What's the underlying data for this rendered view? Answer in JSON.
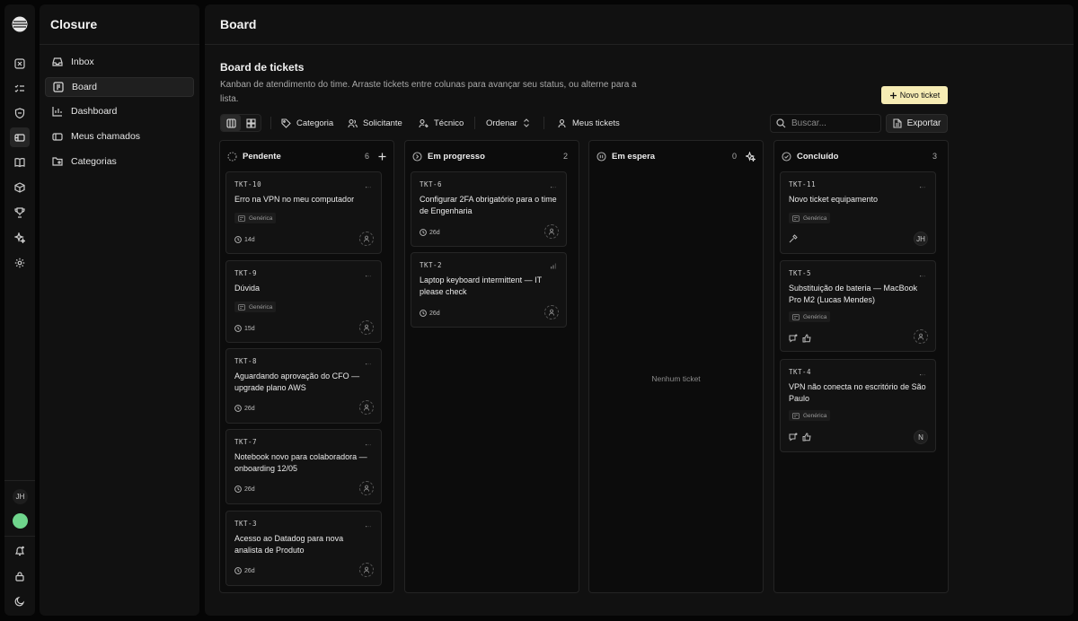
{
  "app": {
    "name": "Closure"
  },
  "rail": {
    "avatar_initials": "JH"
  },
  "sidebar": {
    "items": [
      {
        "label": "Inbox",
        "icon": "inbox-icon"
      },
      {
        "label": "Board",
        "icon": "board-icon",
        "active": true
      },
      {
        "label": "Dashboard",
        "icon": "chart-icon"
      },
      {
        "label": "Meus chamados",
        "icon": "ticket-icon"
      },
      {
        "label": "Categorias",
        "icon": "folder-tag-icon"
      }
    ]
  },
  "header": {
    "title": "Board"
  },
  "section": {
    "title": "Board de tickets",
    "description": "Kanban de atendimento do time. Arraste tickets entre colunas para avançar seu status, ou alterne para a lista."
  },
  "actions": {
    "new_ticket": "Novo ticket",
    "export": "Exportar"
  },
  "toolbar": {
    "filters": [
      "Categoria",
      "Solicitante",
      "Técnico"
    ],
    "sort_label": "Ordenar",
    "my_tickets": "Meus tickets",
    "search_placeholder": "Buscar..."
  },
  "columns": [
    {
      "name": "Pendente",
      "count": "6",
      "cards": [
        {
          "id": "TKT-10",
          "title": "Erro na VPN no meu computador",
          "tag": "Genérica",
          "age": "14d"
        },
        {
          "id": "TKT-9",
          "title": "Dúvida",
          "tag": "Genérica",
          "age": "15d"
        },
        {
          "id": "TKT-8",
          "title": "Aguardando aprovação do CFO — upgrade plano AWS",
          "age": "26d"
        },
        {
          "id": "TKT-7",
          "title": "Notebook novo para colaboradora — onboarding 12/05",
          "age": "26d"
        },
        {
          "id": "TKT-3",
          "title": "Acesso ao Datadog para nova analista de Produto",
          "age": "26d"
        }
      ]
    },
    {
      "name": "Em progresso",
      "count": "2",
      "cards": [
        {
          "id": "TKT-6",
          "title": "Configurar 2FA obrigatório para o time de Engenharia",
          "age": "26d"
        },
        {
          "id": "TKT-2",
          "title": "Laptop keyboard intermittent — IT please check",
          "age": "26d"
        }
      ]
    },
    {
      "name": "Em espera",
      "count": "0",
      "empty_text": "Nenhum ticket"
    },
    {
      "name": "Concluído",
      "count": "3",
      "cards": [
        {
          "id": "TKT-11",
          "title": "Novo ticket equipamento",
          "tag": "Genérica",
          "assignee": "JH"
        },
        {
          "id": "TKT-5",
          "title": "Substituição de bateria — MacBook Pro M2 (Lucas Mendes)",
          "tag": "Genérica"
        },
        {
          "id": "TKT-4",
          "title": "VPN não conecta no escritório de São Paulo",
          "tag": "Genérica",
          "assignee": "N"
        }
      ]
    }
  ]
}
